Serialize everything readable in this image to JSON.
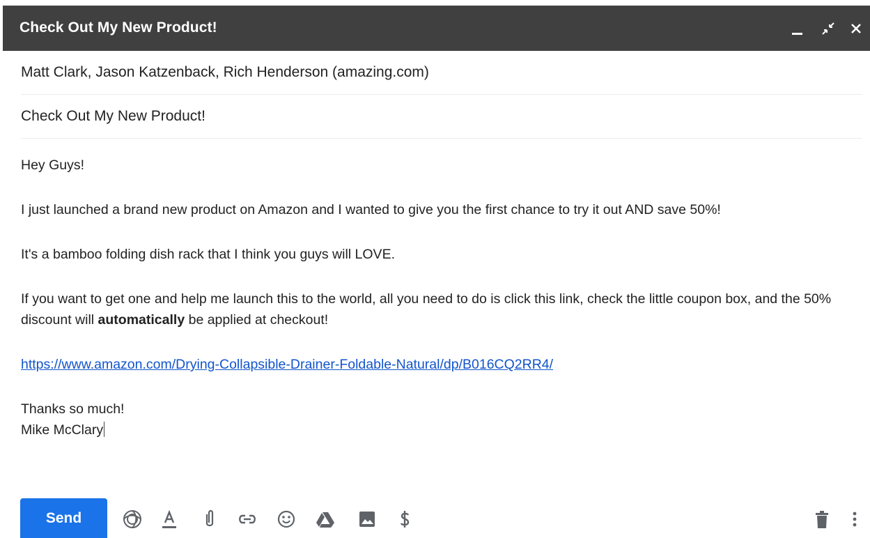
{
  "window": {
    "title": "Check Out My New Product!"
  },
  "compose": {
    "recipients": "Matt Clark, Jason Katzenback, Rich Henderson (amazing.com)",
    "subject": "Check Out My New Product!",
    "body": {
      "greeting": "Hey Guys!",
      "paragraph_1": "I just launched a brand new product on Amazon and I wanted to give you the first chance to try it out AND save 50%!",
      "paragraph_2": "It's a bamboo folding dish rack that I think you guys will LOVE.",
      "paragraph_3_before": "If you want to get one and help me launch this to the world, all you need to do is click this link, check the little coupon box, and the 50% discount will ",
      "paragraph_3_bold": "automatically",
      "paragraph_3_after": " be applied at checkout!",
      "link": "https://www.amazon.com/Drying-Collapsible-Drainer-Foldable-Natural/dp/B016CQ2RR4/",
      "signoff": "Thanks so much!",
      "signature": "Mike McClary"
    }
  },
  "toolbar": {
    "send_label": "Send",
    "icons": [
      "templates-icon",
      "formatting-icon",
      "attach-icon",
      "link-icon",
      "emoji-icon",
      "drive-icon",
      "photo-icon",
      "dollar-icon",
      "trash-icon",
      "more-options-icon"
    ]
  },
  "colors": {
    "titlebar": "#404040",
    "send_button": "#1a73e8",
    "link": "#1155cc",
    "icons": "#5f6368"
  }
}
